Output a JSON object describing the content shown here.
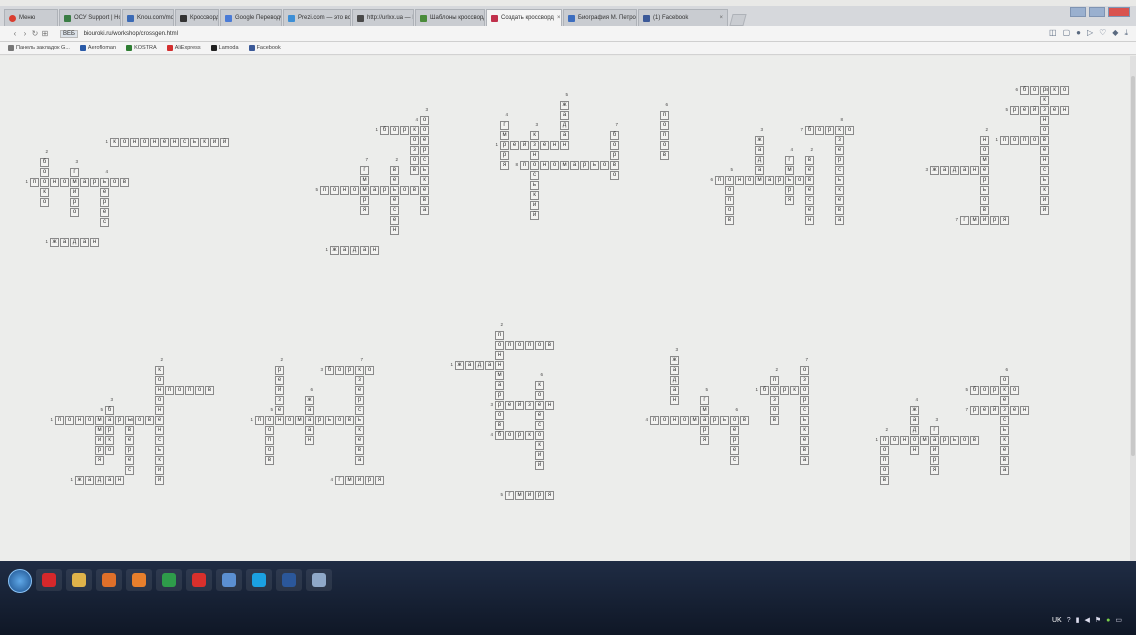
{
  "browser": {
    "tabs": [
      {
        "label": "Меню",
        "color": "#d93d2f",
        "active": false
      },
      {
        "label": "ОСУ Support | Новости",
        "color": "#3a7d44",
        "active": false
      },
      {
        "label": "Knou.com/mosfest/gt/gn",
        "color": "#3b6ab5",
        "active": false
      },
      {
        "label": "Кроссворды",
        "color": "#333333",
        "active": false
      },
      {
        "label": "Google Переводчик",
        "color": "#4a7bd6",
        "active": false
      },
      {
        "label": "Prezi.com — это всё",
        "color": "#3d8fd6",
        "active": false
      },
      {
        "label": "http://urlxx.ua — Поэт",
        "color": "#4a4a4a",
        "active": false
      },
      {
        "label": "Шаблоны кроссворда",
        "color": "#4a8b3a",
        "active": false
      },
      {
        "label": "Создать кроссворд",
        "color": "#c0304b",
        "active": true
      },
      {
        "label": "Биография М. Петро",
        "color": "#3c6dbf",
        "active": false
      },
      {
        "label": "(1) Facebook",
        "color": "#3b5998",
        "active": false
      }
    ],
    "url": "biouroki.ru/workshop/crossgen.html",
    "url_badge": "ВЕБ",
    "bookmarks": [
      {
        "label": "Панель закладок G...",
        "color": "#777777"
      },
      {
        "label": "Aerofloman",
        "color": "#2a5aa8"
      },
      {
        "label": "KOSTRA",
        "color": "#2e7d32"
      },
      {
        "label": "AliExpress",
        "color": "#d32f2f"
      },
      {
        "label": "Lamoda",
        "color": "#222222"
      },
      {
        "label": "Facebook",
        "color": "#3b5998"
      }
    ]
  },
  "crosswords": [
    {
      "words": [
        {
          "text": "КОНОНЕНСЬКИЙ",
          "dir": "across",
          "n": "1"
        },
        {
          "text": "ПОНОМАРЬОВ",
          "dir": "across",
          "n": "1"
        },
        {
          "text": "ЖАДАН",
          "dir": "across",
          "n": "1"
        },
        {
          "text": "БОРКО",
          "dir": "down",
          "n": "2"
        },
        {
          "text": "ГМИРО",
          "dir": "down",
          "n": "3"
        },
        {
          "text": "ВЕРЕС",
          "dir": "down",
          "n": "4"
        }
      ]
    },
    {
      "words": [
        {
          "text": "БОРКО",
          "dir": "across",
          "n": "1"
        },
        {
          "text": "ПОНОМАРЬОВ",
          "dir": "across",
          "n": "5"
        },
        {
          "text": "ЖАДАН",
          "dir": "across",
          "n": "1"
        },
        {
          "text": "ПОЗОВ",
          "dir": "down",
          "n": "4"
        },
        {
          "text": "ГМИРЯ",
          "dir": "down",
          "n": "7"
        },
        {
          "text": "ВЕРЕСЕН",
          "dir": "down",
          "n": "2"
        },
        {
          "text": "ОЗЕРСЬКЕВА",
          "dir": "down",
          "n": "3"
        }
      ]
    },
    {
      "words": [
        {
          "text": "РЕЙЗЕН",
          "dir": "across",
          "n": "1"
        },
        {
          "text": "ПОНОМАРЬОВ",
          "dir": "across",
          "n": "8"
        },
        {
          "text": "ГМИРЯ",
          "dir": "down",
          "n": "4"
        },
        {
          "text": "ЖАДАН",
          "dir": "down",
          "n": "5"
        },
        {
          "text": "КОНЕСЬКИЙ",
          "dir": "down",
          "n": "3"
        },
        {
          "text": "БОРКО",
          "dir": "down",
          "n": "7"
        },
        {
          "text": "ПОПОВ",
          "dir": "down",
          "n": "6"
        }
      ]
    },
    {
      "words": [
        {
          "text": "БОРКО",
          "dir": "across",
          "n": "7"
        },
        {
          "text": "ПОНОМАРЬОВ",
          "dir": "across",
          "n": "6"
        },
        {
          "text": "ЖАДАН",
          "dir": "down",
          "n": "3"
        },
        {
          "text": "ПОПОВ",
          "dir": "down",
          "n": "5"
        },
        {
          "text": "ГМИРЯ",
          "dir": "down",
          "n": "4"
        },
        {
          "text": "ВЕРЕСЕН",
          "dir": "down",
          "n": "2"
        },
        {
          "text": "ОЗЕРСЬКЕВА",
          "dir": "down",
          "n": "8"
        }
      ]
    },
    {
      "words": [
        {
          "text": "БОРКО",
          "dir": "across",
          "n": "6"
        },
        {
          "text": "РЕЙЗЕН",
          "dir": "across",
          "n": "5"
        },
        {
          "text": "ПОПОВ",
          "dir": "across",
          "n": "1"
        },
        {
          "text": "ЖАДАН",
          "dir": "across",
          "n": "3"
        },
        {
          "text": "ГМИРЯ",
          "dir": "across",
          "n": "7"
        },
        {
          "text": "КОНОНЕНСЬКИЙ",
          "dir": "down",
          "n": "4"
        },
        {
          "text": "НОМЕРЬОВ",
          "dir": "down",
          "n": "2"
        }
      ]
    },
    {
      "words": [
        {
          "text": "ПОПОВ",
          "dir": "across",
          "n": "4"
        },
        {
          "text": "ПОНОМАРЬОВ",
          "dir": "across",
          "n": "1"
        },
        {
          "text": "ЖАДАН",
          "dir": "across",
          "n": "1"
        },
        {
          "text": "КОНОНЕНСЬКИЙ",
          "dir": "down",
          "n": "2"
        },
        {
          "text": "БОРКО",
          "dir": "down",
          "n": "3"
        },
        {
          "text": "ГМИРЯ",
          "dir": "down",
          "n": "5"
        },
        {
          "text": "ВЕРЕС",
          "dir": "down",
          "n": "6"
        }
      ]
    },
    {
      "words": [
        {
          "text": "БОРКО",
          "dir": "across",
          "n": "3"
        },
        {
          "text": "ПОНОМАРЬОВ",
          "dir": "across",
          "n": "1"
        },
        {
          "text": "ГМИРЯ",
          "dir": "across",
          "n": "4"
        },
        {
          "text": "РЕЙЗЕН",
          "dir": "down",
          "n": "2"
        },
        {
          "text": "ПОПОВ",
          "dir": "down",
          "n": "5"
        },
        {
          "text": "ЖАДАН",
          "dir": "down",
          "n": "6"
        },
        {
          "text": "ОЗЕРСЬКЕВА",
          "dir": "down",
          "n": "7"
        }
      ]
    },
    {
      "words": [
        {
          "text": "ПОПОВ",
          "dir": "across",
          "n": "2"
        },
        {
          "text": "ЖАДАН",
          "dir": "across",
          "n": "1"
        },
        {
          "text": "РЕЙЗЕН",
          "dir": "across",
          "n": "3"
        },
        {
          "text": "БОРКО",
          "dir": "across",
          "n": "4"
        },
        {
          "text": "ГМИРЯ",
          "dir": "across",
          "n": "5"
        },
        {
          "text": "ПОНОМАРЬОВ",
          "dir": "down",
          "n": "2"
        },
        {
          "text": "КОНЕСЬКИЙ",
          "dir": "down",
          "n": "6"
        }
      ]
    },
    {
      "words": [
        {
          "text": "БОРКО",
          "dir": "across",
          "n": "1"
        },
        {
          "text": "ПОНОМАРЬОВ",
          "dir": "across",
          "n": "4"
        },
        {
          "text": "ЖАДАН",
          "dir": "down",
          "n": "3"
        },
        {
          "text": "ГМИРЯ",
          "dir": "down",
          "n": "5"
        },
        {
          "text": "ВЕРЕС",
          "dir": "down",
          "n": "6"
        },
        {
          "text": "ПОЗОВ",
          "dir": "down",
          "n": "2"
        },
        {
          "text": "ОЗЕРСЬКЕВА",
          "dir": "down",
          "n": "7"
        }
      ]
    },
    {
      "words": [
        {
          "text": "БОРКО",
          "dir": "across",
          "n": "5"
        },
        {
          "text": "РЕЙЗЕН",
          "dir": "across",
          "n": "7"
        },
        {
          "text": "ПОНОМАРЬОВ",
          "dir": "across",
          "n": "1"
        },
        {
          "text": "ЖАДАН",
          "dir": "down",
          "n": "4"
        },
        {
          "text": "ГМИРЯ",
          "dir": "down",
          "n": "3"
        },
        {
          "text": "ПОПОВ",
          "dir": "down",
          "n": "2"
        },
        {
          "text": "ОЗЕРСЬКЕВА",
          "dir": "down",
          "n": "6"
        }
      ]
    }
  ],
  "taskbar": {
    "apps": [
      {
        "name": "opera-app",
        "color": "#d6282b"
      },
      {
        "name": "explorer-app",
        "color": "#e0b34a"
      },
      {
        "name": "media-app",
        "color": "#e0702a"
      },
      {
        "name": "firefox-app",
        "color": "#e87f2c"
      },
      {
        "name": "chrome-app",
        "color": "#2e9c4a"
      },
      {
        "name": "yandex-app",
        "color": "#d9302c"
      },
      {
        "name": "settings-app",
        "color": "#5b8fd1"
      },
      {
        "name": "skype-app",
        "color": "#1ba1e2"
      },
      {
        "name": "word-app",
        "color": "#2b579a"
      },
      {
        "name": "files-app",
        "color": "#8fa8c8"
      }
    ],
    "lang": "UK"
  }
}
